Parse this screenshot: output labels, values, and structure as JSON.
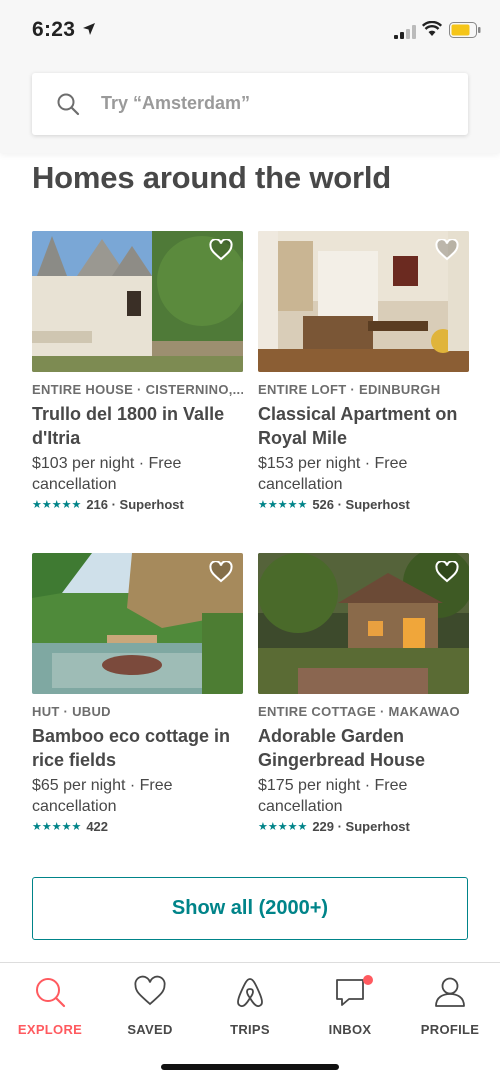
{
  "status_bar": {
    "time": "6:23"
  },
  "search": {
    "placeholder": "Try “Amsterdam”"
  },
  "section": {
    "title": "Homes around the world"
  },
  "listings": [
    {
      "type": "ENTIRE HOUSE · CISTERNINO,...",
      "title": "Trullo del 1800 in Valle d'Itria",
      "price": "$103 per night · Free cancellation",
      "stars": "★★★★★",
      "rating": "216 · Superhost"
    },
    {
      "type": "ENTIRE LOFT · EDINBURGH",
      "title": "Classical Apartment on Royal Mile",
      "price": "$153 per night · Free cancellation",
      "stars": "★★★★★",
      "rating": "526 · Superhost"
    },
    {
      "type": "HUT · UBUD",
      "title": "Bamboo eco cottage in rice fields",
      "price": "$65 per night · Free cancellation",
      "stars": "★★★★★",
      "rating": "422"
    },
    {
      "type": "ENTIRE COTTAGE · MAKAWAO",
      "title": "Adorable Garden Gingerbread House",
      "price": "$175 per night · Free cancellation",
      "stars": "★★★★★",
      "rating": "229 · Superhost"
    }
  ],
  "show_all": {
    "label": "Show all (2000+)"
  },
  "tabs": [
    {
      "label": "EXPLORE",
      "icon": "search-icon",
      "active": true
    },
    {
      "label": "SAVED",
      "icon": "heart-icon"
    },
    {
      "label": "TRIPS",
      "icon": "airbnb-logo-icon"
    },
    {
      "label": "INBOX",
      "icon": "chat-bubble-icon"
    },
    {
      "label": "PROFILE",
      "icon": "person-icon"
    }
  ],
  "colors": {
    "accent": "#008489",
    "brand": "#ff5a5f",
    "text": "#484848",
    "battery": "#f5c518"
  }
}
